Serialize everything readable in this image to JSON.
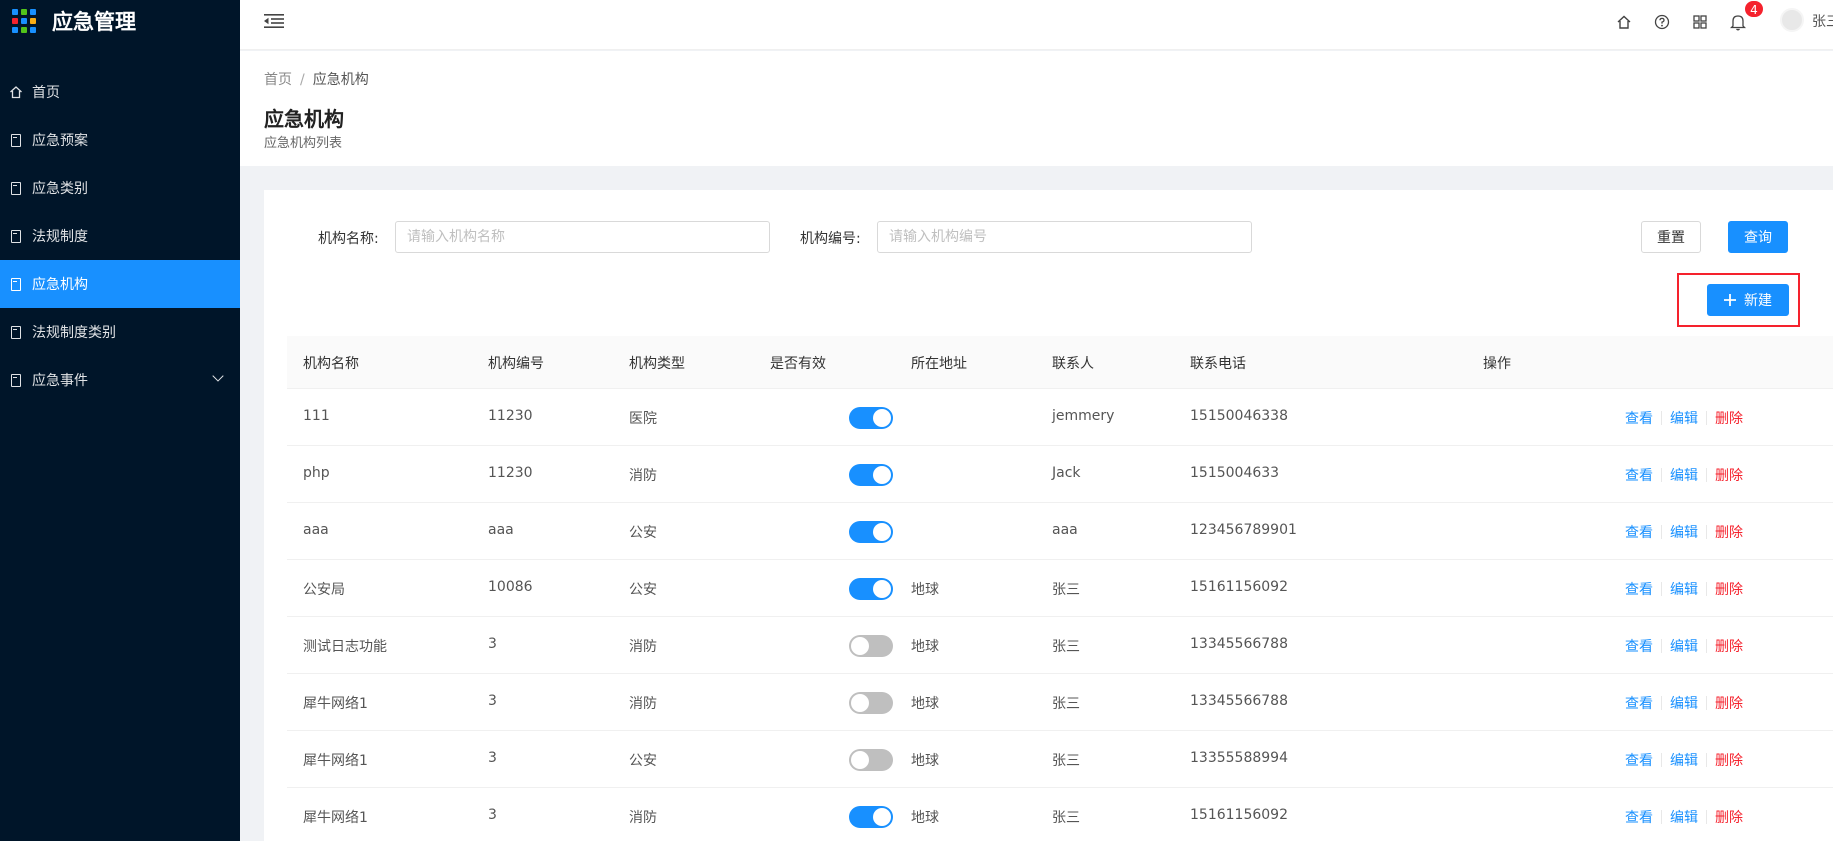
{
  "app": {
    "title": "应急管理"
  },
  "sidebar": {
    "items": [
      {
        "label": "首页",
        "icon": "home-icon"
      },
      {
        "label": "应急预案",
        "icon": "document-icon"
      },
      {
        "label": "应急类别",
        "icon": "document-icon"
      },
      {
        "label": "法规制度",
        "icon": "document-icon"
      },
      {
        "label": "应急机构",
        "icon": "document-icon",
        "active": true
      },
      {
        "label": "法规制度类别",
        "icon": "document-icon"
      },
      {
        "label": "应急事件",
        "icon": "document-icon",
        "expandable": true
      }
    ]
  },
  "header": {
    "notification_count": "4",
    "username": "张三"
  },
  "breadcrumb": {
    "home": "首页",
    "separator": "/",
    "current": "应急机构"
  },
  "page": {
    "title": "应急机构",
    "subtitle": "应急机构列表"
  },
  "filters": {
    "name_label": "机构名称:",
    "name_placeholder": "请输入机构名称",
    "code_label": "机构编号:",
    "code_placeholder": "请输入机构编号",
    "reset_label": "重置",
    "query_label": "查询",
    "new_label": "新建"
  },
  "table": {
    "columns": [
      "机构名称",
      "机构编号",
      "机构类型",
      "是否有效",
      "所在地址",
      "联系人",
      "联系电话",
      "操作"
    ],
    "actions": {
      "view": "查看",
      "edit": "编辑",
      "delete": "删除"
    },
    "rows": [
      {
        "name": "111",
        "code": "11230",
        "type": "医院",
        "valid": true,
        "address": "",
        "contact": "jemmery",
        "phone": "15150046338"
      },
      {
        "name": "php",
        "code": "11230",
        "type": "消防",
        "valid": true,
        "address": "",
        "contact": "Jack",
        "phone": "1515004633"
      },
      {
        "name": "aaa",
        "code": "aaa",
        "type": "公安",
        "valid": true,
        "address": "",
        "contact": "aaa",
        "phone": "123456789901"
      },
      {
        "name": "公安局",
        "code": "10086",
        "type": "公安",
        "valid": true,
        "address": "地球",
        "contact": "张三",
        "phone": "15161156092"
      },
      {
        "name": "测试日志功能",
        "code": "3",
        "type": "消防",
        "valid": false,
        "address": "地球",
        "contact": "张三",
        "phone": "13345566788"
      },
      {
        "name": "犀牛网络1",
        "code": "3",
        "type": "消防",
        "valid": false,
        "address": "地球",
        "contact": "张三",
        "phone": "13345566788"
      },
      {
        "name": "犀牛网络1",
        "code": "3",
        "type": "公安",
        "valid": false,
        "address": "地球",
        "contact": "张三",
        "phone": "13355588994"
      },
      {
        "name": "犀牛网络1",
        "code": "3",
        "type": "消防",
        "valid": true,
        "address": "地球",
        "contact": "张三",
        "phone": "15161156092"
      }
    ]
  },
  "colors": {
    "sidebar_bg": "#001529",
    "primary": "#1890ff",
    "danger": "#f5222d"
  }
}
